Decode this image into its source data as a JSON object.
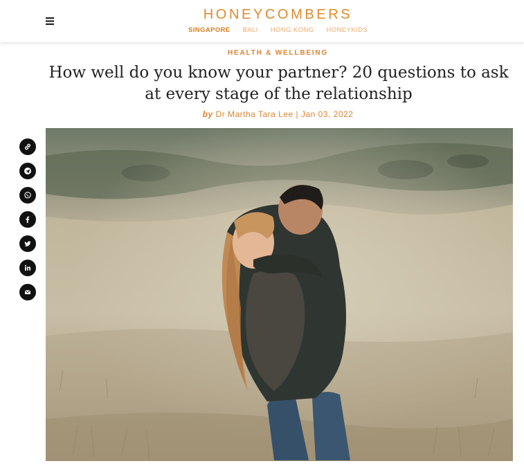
{
  "header": {
    "logo": "HONEYCOMBERS",
    "menu_icon": "hamburger-menu-icon",
    "editions": [
      "SINGAPORE",
      "BALI",
      "HONG KONG",
      "HONEYKIDS"
    ],
    "active_edition": "SINGAPORE"
  },
  "article": {
    "category": "HEALTH & WELLBEING",
    "title": "How well do you know your partner? 20 questions to ask at every stage of the relationship",
    "by": "by",
    "author": "Dr Martha Tara Lee",
    "separator": "|",
    "date": "Jan 03, 2022"
  },
  "share": [
    "link-icon",
    "telegram-icon",
    "whatsapp-icon",
    "facebook-icon",
    "twitter-icon",
    "linkedin-icon",
    "email-icon"
  ],
  "colors": {
    "accent": "#dc8432",
    "logo": "#e08a2c",
    "share_bg": "#111111"
  }
}
